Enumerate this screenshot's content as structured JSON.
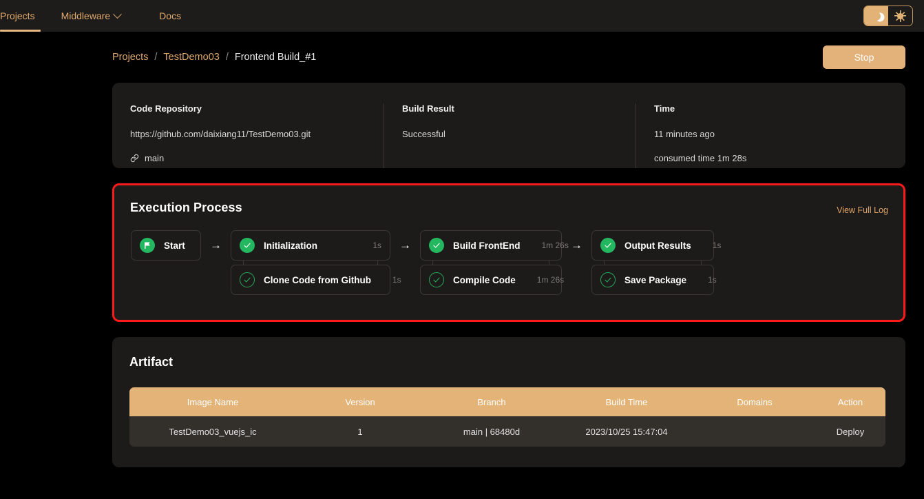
{
  "nav": {
    "items": [
      {
        "label": "Projects",
        "active": true
      },
      {
        "label": "Middleware",
        "has_chevron": true
      },
      {
        "label": "Docs"
      }
    ],
    "theme_toggle": {
      "dark_icon": "moon-icon",
      "light_icon": "sun-icon",
      "selected": "dark"
    }
  },
  "header": {
    "breadcrumb": [
      {
        "label": "Projects"
      },
      {
        "label": "TestDemo03"
      },
      {
        "label": "Frontend Build_#1"
      }
    ],
    "separator": "/",
    "stop_label": "Stop"
  },
  "info": {
    "repo": {
      "title": "Code Repository",
      "url": "https://github.com/daixiang11/TestDemo03.git",
      "branch_icon": "branch-link-icon",
      "branch": "main"
    },
    "result": {
      "title": "Build Result",
      "value": "Successful"
    },
    "time": {
      "title": "Time",
      "relative": "11 minutes ago",
      "consumed": "consumed time 1m 28s"
    }
  },
  "execution": {
    "title": "Execution Process",
    "view_log_label": "View Full Log",
    "start": {
      "label": "Start",
      "icon": "flag-icon"
    },
    "arrow": "→",
    "groups": [
      {
        "parent": {
          "label": "Initialization",
          "duration": "1s",
          "icon": "check-circle-filled-icon"
        },
        "child": {
          "label": "Clone Code from Github",
          "duration": "1s",
          "icon": "check-circle-outline-icon"
        }
      },
      {
        "parent": {
          "label": "Build FrontEnd",
          "duration": "1m 26s",
          "icon": "check-circle-filled-icon"
        },
        "child": {
          "label": "Compile Code",
          "duration": "1m 26s",
          "icon": "check-circle-outline-icon"
        }
      },
      {
        "parent": {
          "label": "Output Results",
          "duration": "1s",
          "icon": "check-circle-filled-icon"
        },
        "child": {
          "label": "Save Package",
          "duration": "1s",
          "icon": "check-circle-outline-icon"
        }
      }
    ],
    "highlight_color": "#fc1b1b"
  },
  "artifact": {
    "title": "Artifact",
    "columns": [
      "Image Name",
      "Version",
      "Branch",
      "Build Time",
      "Domains",
      "Action"
    ],
    "rows": [
      {
        "image_name": "TestDemo03_vuejs_ic",
        "version": "1",
        "branch": "main | 68480d",
        "build_time": "2023/10/25 15:47:04",
        "domains": "",
        "action": "Deploy"
      }
    ]
  },
  "colors": {
    "accent": "#e3b27a",
    "link": "#dfa468",
    "success": "#23b760",
    "page_bg": "#000000",
    "card_bg": "#1c1b1a"
  }
}
